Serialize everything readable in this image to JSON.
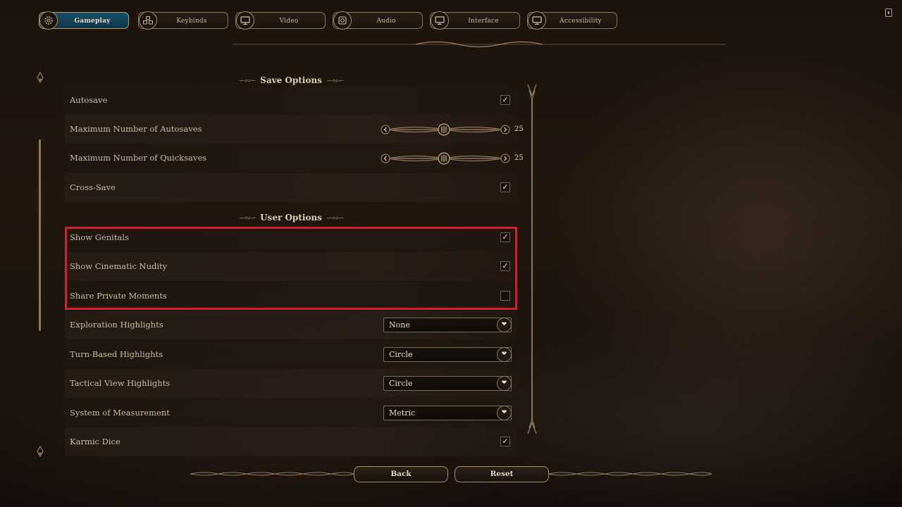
{
  "tabs": [
    {
      "label": "Gameplay",
      "icon": "gear-icon",
      "active": true
    },
    {
      "label": "Keybinds",
      "icon": "keys-icon",
      "active": false
    },
    {
      "label": "Video",
      "icon": "monitor-icon",
      "active": false
    },
    {
      "label": "Audio",
      "icon": "speaker-icon",
      "active": false
    },
    {
      "label": "Interface",
      "icon": "monitor-icon",
      "active": false
    },
    {
      "label": "Accessibility",
      "icon": "monitor-icon",
      "active": false
    }
  ],
  "sections": {
    "save_options": "Save Options",
    "user_options": "User Options"
  },
  "rows": {
    "autosave": {
      "label": "Autosave",
      "checked": true,
      "mark": "✓"
    },
    "max_autosaves": {
      "label": "Maximum Number of Autosaves",
      "value": "25"
    },
    "max_quicksaves": {
      "label": "Maximum Number of Quicksaves",
      "value": "25"
    },
    "cross_save": {
      "label": "Cross-Save",
      "checked": true,
      "mark": "✓"
    },
    "show_genitals": {
      "label": "Show Genitals",
      "checked": true,
      "mark": "✓"
    },
    "cinematic_nudity": {
      "label": "Show Cinematic Nudity",
      "checked": true,
      "mark": "✓"
    },
    "private_moments": {
      "label": "Share Private Moments",
      "checked": false,
      "mark": ""
    },
    "exploration_highlights": {
      "label": "Exploration Highlights",
      "value": "None"
    },
    "turnbased_highlights": {
      "label": "Turn-Based Highlights",
      "value": "Circle"
    },
    "tactical_highlights": {
      "label": "Tactical View Highlights",
      "value": "Circle"
    },
    "measurement": {
      "label": "System of Measurement",
      "value": "Metric"
    },
    "karmic_dice": {
      "label": "Karmic Dice",
      "checked": true,
      "mark": "✓"
    }
  },
  "buttons": {
    "back": "Back",
    "reset": "Reset"
  },
  "colors": {
    "accent": "#17506a",
    "highlight_box": "#d2212d",
    "gold_trim": "#a48c63"
  }
}
